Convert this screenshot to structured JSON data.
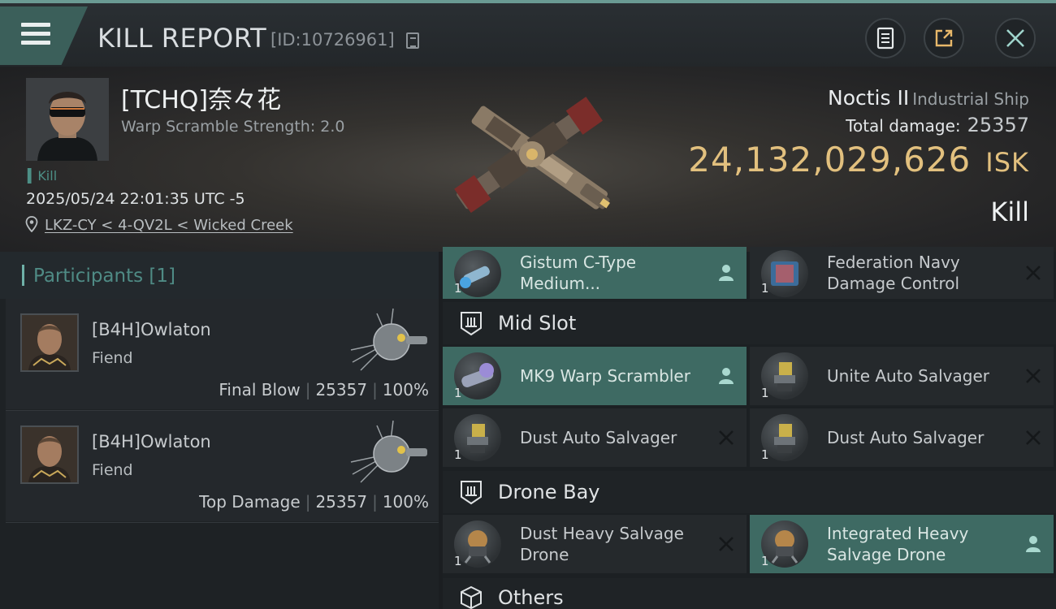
{
  "header": {
    "title": "KILL REPORT",
    "report_id": "[ID:10726961]"
  },
  "victim": {
    "name": "[TCHQ]奈々花",
    "warp_scramble": "Warp Scramble Strength: 2.0",
    "kill_tag": "Kill",
    "datetime": "2025/05/24 22:01:35 UTC -5",
    "location": "LKZ-CY < 4-QV2L < Wicked Creek",
    "ship_name": "Noctis II",
    "ship_class": "Industrial Ship",
    "total_damage_label": "Total damage:",
    "total_damage": "25357",
    "isk_value": "24,132,029,626",
    "isk_unit": "ISK",
    "result": "Kill"
  },
  "participants": {
    "title": "Participants",
    "count": "[1]",
    "items": [
      {
        "name": "[B4H]Owlaton",
        "ship": "Fiend",
        "role": "Final Blow",
        "damage": "25357",
        "percent": "100%"
      },
      {
        "name": "[B4H]Owlaton",
        "ship": "Fiend",
        "role": "Top Damage",
        "damage": "25357",
        "percent": "100%"
      }
    ]
  },
  "fitting": {
    "low_slots": [
      {
        "name": "Gistum C-Type Medium...",
        "qty": "1",
        "status": "person",
        "active": true
      },
      {
        "name": "Federation Navy Damage Control",
        "qty": "1",
        "status": "destroyed",
        "active": false
      }
    ],
    "mid_slot": {
      "title": "Mid Slot",
      "items": [
        {
          "name": "MK9 Warp Scrambler",
          "qty": "1",
          "status": "person",
          "active": true
        },
        {
          "name": "Unite Auto Salvager",
          "qty": "1",
          "status": "destroyed",
          "active": false
        },
        {
          "name": "Dust Auto Salvager",
          "qty": "1",
          "status": "destroyed",
          "active": false
        },
        {
          "name": "Dust Auto Salvager",
          "qty": "1",
          "status": "destroyed",
          "active": false
        }
      ]
    },
    "drone_bay": {
      "title": "Drone Bay",
      "items": [
        {
          "name": "Dust Heavy Salvage Drone",
          "qty": "1",
          "status": "destroyed",
          "active": false
        },
        {
          "name": "Integrated Heavy Salvage Drone",
          "qty": "1",
          "status": "person",
          "active": true
        }
      ]
    },
    "others": {
      "title": "Others"
    }
  },
  "colors": {
    "accent": "#6fb1a8",
    "active_slot": "#3e6a63",
    "isk_gold": "#e2c07e"
  }
}
